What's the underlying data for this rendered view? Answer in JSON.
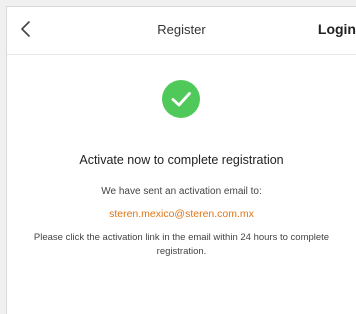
{
  "header": {
    "back_icon": "chevron-left-icon",
    "title": "Register",
    "login_label": "Login"
  },
  "status": {
    "icon": "check-circle-icon",
    "icon_color": "#4fc95a",
    "headline": "Activate now to complete registration"
  },
  "message": {
    "sent_text": "We have sent an activation email to:",
    "email": "steren.mexico@steren.com.mx",
    "email_color": "#e07515",
    "instructions": "Please click the activation link in the email within 24 hours to complete registration."
  }
}
